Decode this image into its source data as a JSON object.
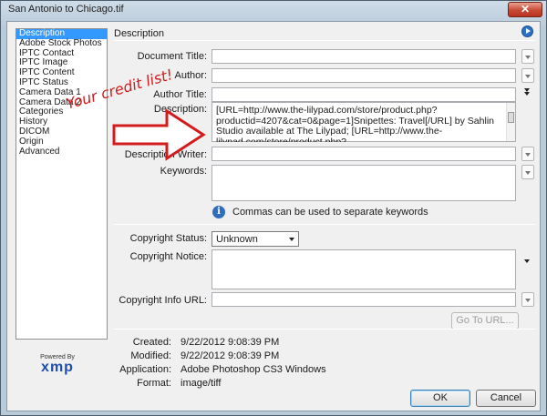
{
  "window": {
    "title": "San Antonio to Chicago.tif",
    "close_glyph": "✕"
  },
  "sidebar": {
    "items": [
      {
        "label": "Description",
        "selected": true
      },
      {
        "label": "Adobe Stock Photos"
      },
      {
        "label": "IPTC Contact"
      },
      {
        "label": "IPTC Image"
      },
      {
        "label": "IPTC Content"
      },
      {
        "label": "IPTC Status"
      },
      {
        "label": "Camera Data 1"
      },
      {
        "label": "Camera Data 2"
      },
      {
        "label": "Categories"
      },
      {
        "label": "History"
      },
      {
        "label": "DICOM"
      },
      {
        "label": "Origin"
      },
      {
        "label": "Advanced"
      }
    ]
  },
  "logo": {
    "powered_by": "Powered By",
    "brand": "xmp"
  },
  "panel": {
    "title": "Description",
    "info_icon": "play-circle-icon"
  },
  "fields": {
    "document_title": {
      "label": "Document Title:",
      "value": ""
    },
    "author": {
      "label": "Author:",
      "value": ""
    },
    "author_title": {
      "label": "Author Title:",
      "value": ""
    },
    "description": {
      "label": "Description:",
      "value": "[URL=http://www.the-lilypad.com/store/product.php?productid=4207&cat=0&page=1]Snipettes: Travel[/URL] by Sahlin Studio available at The Lilypad; [URL=http://www.the-lilypad.com/store/product.php?"
    },
    "description_writer": {
      "label": "Description Writer:",
      "value": ""
    },
    "keywords": {
      "label": "Keywords:",
      "value": ""
    },
    "keywords_hint": "Commas can be used to separate keywords",
    "copyright_status": {
      "label": "Copyright Status:",
      "value": "Unknown"
    },
    "copyright_notice": {
      "label": "Copyright Notice:",
      "value": ""
    },
    "copyright_url": {
      "label": "Copyright Info URL:",
      "value": ""
    },
    "go_to_url": "Go To URL..."
  },
  "meta": [
    {
      "label": "Created:",
      "value": "9/22/2012 9:08:39 PM"
    },
    {
      "label": "Modified:",
      "value": "9/22/2012 9:08:39 PM"
    },
    {
      "label": "Application:",
      "value": "Adobe Photoshop CS3 Windows"
    },
    {
      "label": "Format:",
      "value": "image/tiff"
    }
  ],
  "buttons": {
    "ok": "OK",
    "cancel": "Cancel"
  },
  "annotation": {
    "text": "Your credit list!",
    "color": "#d41b1b"
  }
}
